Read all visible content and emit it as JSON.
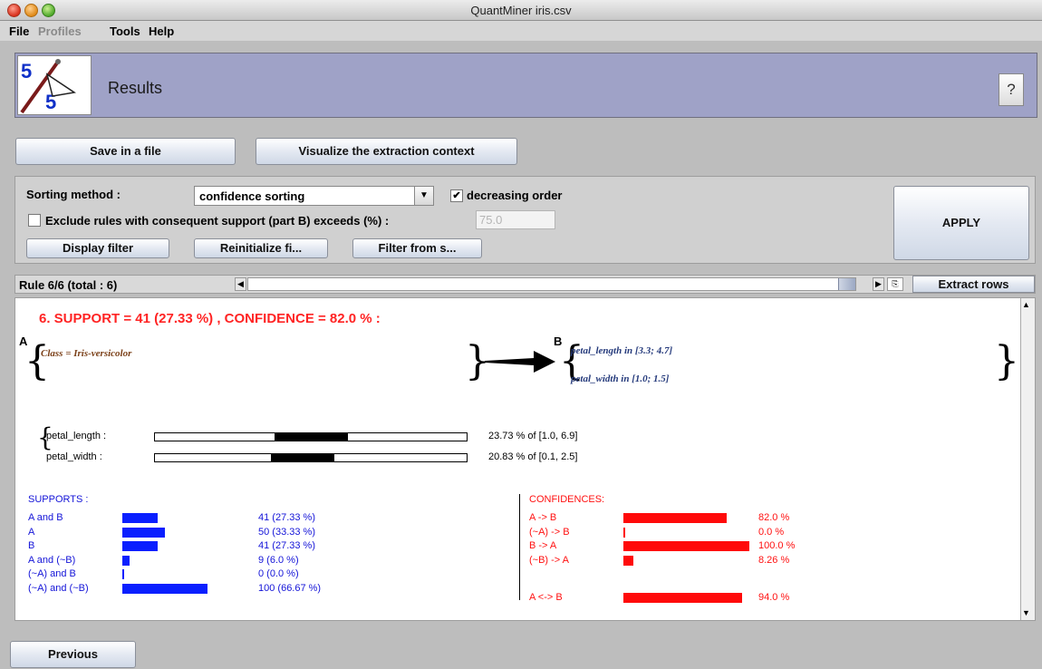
{
  "window": {
    "title": "QuantMiner iris.csv"
  },
  "menu": [
    "File",
    "Profiles",
    "Tools",
    "Help"
  ],
  "banner": {
    "title": "Results",
    "help_label": "?"
  },
  "actions": {
    "save": "Save in a file",
    "visualize": "Visualize the extraction context"
  },
  "filter": {
    "sorting_label": "Sorting method :",
    "sorting_value": "confidence sorting",
    "decreasing_label": "decreasing order",
    "decreasing_checked": true,
    "exclude_label": "Exclude rules with consequent support (part B) exceeds (%) :",
    "exclude_checked": false,
    "exclude_value": "75.0",
    "display_filter": "Display filter",
    "reinitialize": "Reinitialize fi...",
    "filter_from": "Filter from s...",
    "apply": "APPLY"
  },
  "rulebar": {
    "label": "Rule 6/6 (total : 6)",
    "extract": "Extract rows"
  },
  "rule": {
    "headline": "6. SUPPORT = 41 (27.33 %) , CONFIDENCE = 82.0 % :",
    "a_label": "A",
    "b_label": "B",
    "antecedent": [
      "Class = Iris-versicolor"
    ],
    "consequent": [
      "petal_length in [3.3; 4.7]",
      "petal_width in [1.0; 1.5]"
    ]
  },
  "intervals": [
    {
      "name": "petal_length :",
      "text": "23.73 % of [1.0, 6.9]",
      "start": 0.385,
      "end": 0.62
    },
    {
      "name": "petal_width :",
      "text": "20.83 % of [0.1, 2.5]",
      "start": 0.372,
      "end": 0.575
    }
  ],
  "supports": {
    "title": "SUPPORTS :",
    "rows": [
      {
        "label": "A and B",
        "value": "41 (27.33 %)",
        "pct": 27.33
      },
      {
        "label": "A",
        "value": "50 (33.33 %)",
        "pct": 33.33
      },
      {
        "label": "B",
        "value": "41 (27.33 %)",
        "pct": 27.33
      },
      {
        "label": "A and (~B)",
        "value": "9 (6.0 %)",
        "pct": 6.0
      },
      {
        "label": "(~A) and B",
        "value": "0 (0.0 %)",
        "pct": 0.0
      },
      {
        "label": "(~A) and (~B)",
        "value": "100 (66.67 %)",
        "pct": 66.67
      }
    ]
  },
  "confidences": {
    "title": "CONFIDENCES:",
    "rows": [
      {
        "label": "A -> B",
        "value": "82.0 %",
        "pct": 82.0
      },
      {
        "label": "(~A) -> B",
        "value": "0.0 %",
        "pct": 0.0
      },
      {
        "label": "B -> A",
        "value": "100.0 %",
        "pct": 100.0
      },
      {
        "label": "(~B) -> A",
        "value": "8.26 %",
        "pct": 8.26
      }
    ],
    "equiv": {
      "label": "A <-> B",
      "value": "94.0 %",
      "pct": 94.0
    }
  },
  "nav": {
    "previous": "Previous"
  }
}
